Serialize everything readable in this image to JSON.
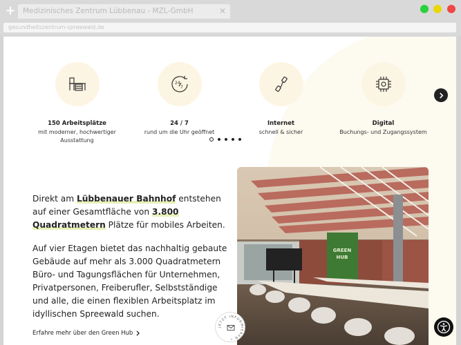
{
  "browser": {
    "tab_title": "Medizinisches Zentrum Lübbenau - MZL-GmbH",
    "url": "gesundheitszentrum-spreewald.de",
    "new_tab_icon": "plus-icon",
    "close_icon": "close-icon"
  },
  "features": [
    {
      "icon": "desk-icon",
      "title": "150 Arbeitsplätze",
      "desc": "mit moderner, hochwertiger Ausstattung"
    },
    {
      "icon": "clock-24-7-icon",
      "title": "24 / 7",
      "desc": "rund um die Uhr geöffnet"
    },
    {
      "icon": "cable-icon",
      "title": "Internet",
      "desc": "schnell & sicher"
    },
    {
      "icon": "digital-booking-icon",
      "title": "Digital",
      "desc": "Buchungs- und Zugangssystem"
    }
  ],
  "carousel": {
    "pages": 5,
    "active": 0
  },
  "intro": {
    "p1_a": "Direkt am ",
    "p1_b": "Lübbenauer Bahnhof",
    "p1_c": " entstehen auf einer Gesamtfläche von ",
    "p1_d": "3.800 Quadratmetern",
    "p1_e": " Plätze für mobiles Arbeiten.",
    "p2": "Auf vier Etagen bietet das nachhaltig gebaute Gebäude auf mehr als 3.000 Quadratmetern Büro- und Tagungsflächen für Unternehmen, Privatpersonen, Freiberufler, Selbstständige und alle, die einen flexiblen Arbeitsplatz im idyllischen Spreewald suchen."
  },
  "link": {
    "label": "Erfahre mehr über den Green Hub"
  },
  "badge": {
    "text": "JETZT INFORMIEREN •"
  },
  "photo": {
    "wall_text_1": "GREEN",
    "wall_text_2": "HUB"
  },
  "colors": {
    "feature_circle": "#fdf5e3",
    "highlight": "#e8f0b8",
    "dark": "#222222"
  }
}
